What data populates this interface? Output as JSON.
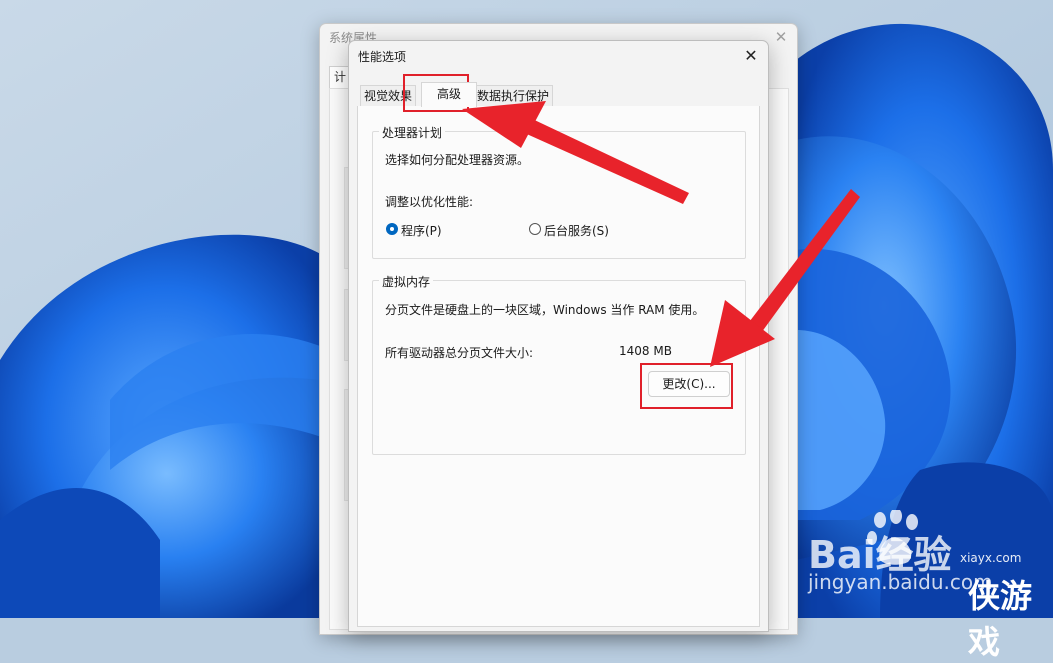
{
  "background_window": {
    "title": "系统属性",
    "close_glyph": "✕",
    "partial_tab_label": "计"
  },
  "dialog": {
    "title": "性能选项",
    "close_glyph": "✕",
    "tabs": [
      {
        "label": "视觉效果"
      },
      {
        "label": "高级"
      },
      {
        "label": "数据执行保护"
      }
    ],
    "processor": {
      "group_title": "处理器计划",
      "description": "选择如何分配处理器资源。",
      "adjust_label": "调整以优化性能:",
      "options": [
        {
          "label": "程序(P)",
          "selected": true
        },
        {
          "label": "后台服务(S)",
          "selected": false
        }
      ]
    },
    "virtual_memory": {
      "group_title": "虚拟内存",
      "description": "分页文件是硬盘上的一块区域，Windows 当作 RAM 使用。",
      "total_label": "所有驱动器总分页文件大小:",
      "total_value": "1408 MB",
      "change_button": "更改(C)..."
    }
  },
  "annotations": {
    "highlight_color": "#e0202a",
    "arrow_color": "#e8232b"
  },
  "watermark": {
    "baidu_text": "Bai经验",
    "jingyan_text": "jingyan.baidu.com",
    "site": "xiayx.com",
    "brand": "侠游戏"
  }
}
